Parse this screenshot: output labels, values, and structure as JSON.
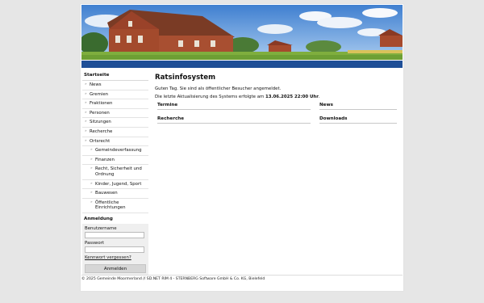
{
  "nav": {
    "title": "Startseite",
    "items": [
      {
        "label": "News"
      },
      {
        "label": "Gremien"
      },
      {
        "label": "Fraktionen"
      },
      {
        "label": "Personen"
      },
      {
        "label": "Sitzungen"
      },
      {
        "label": "Recherche"
      },
      {
        "label": "Ortsrecht"
      }
    ],
    "sub_items": [
      {
        "label": "Gemeindeverfassung"
      },
      {
        "label": "Finanzen"
      },
      {
        "label": "Recht, Sicherheit und Ordnung"
      },
      {
        "label": "Kinder, Jugend, Sport"
      },
      {
        "label": "Bauwesen"
      },
      {
        "label": "Öffentliche Einrichtungen"
      }
    ]
  },
  "login": {
    "title": "Anmeldung",
    "username_label": "Benutzername",
    "username_value": "",
    "password_label": "Passwort",
    "password_value": "",
    "forgot_link": "Kennwort vergessen?",
    "submit_label": "Anmelden"
  },
  "main": {
    "title": "Ratsinfosystem",
    "greeting": "Guten Tag. Sie sind als öffentlicher Besucher angemeldet.",
    "update_prefix": "Die letzte Aktualisierung des Systems erfolgte am",
    "update_value": "13.06.2025 22:00 Uhr",
    "update_suffix": "."
  },
  "panels": {
    "termine": "Termine",
    "news": "News",
    "recherche": "Recherche",
    "downloads": "Downloads"
  },
  "footer": {
    "text": "© 2025 Gemeinde Moormerland // SD.NET RIM 4 - STERNBERG Software GmbH & Co. KG, Bielefeld"
  },
  "colors": {
    "accent_bar": "#1f4f97",
    "page_bg": "#e6e6e6"
  }
}
